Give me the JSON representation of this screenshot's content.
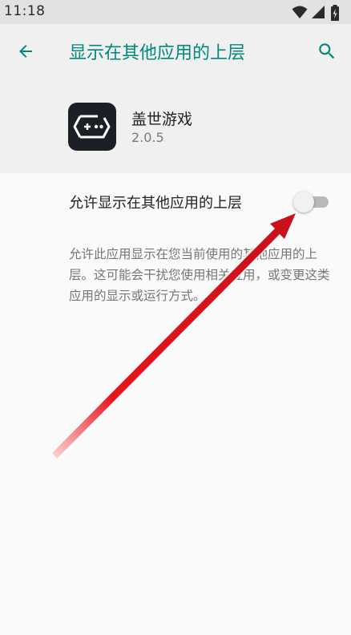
{
  "status_bar": {
    "time": "11:18",
    "icons": [
      "wifi-icon",
      "signal-icon",
      "battery-icon"
    ]
  },
  "toolbar": {
    "title": "显示在其他应用的上层",
    "back_icon": "back-arrow-icon",
    "search_icon": "search-icon"
  },
  "app": {
    "name": "盖世游戏",
    "version": "2.0.5",
    "icon": "gamepad-icon"
  },
  "setting": {
    "label": "允许显示在其他应用的上层",
    "enabled": false
  },
  "description": "允许此应用显示在您当前使用的其他应用的上层。这可能会干扰您使用相关应用，或变更这类应用的显示或运行方式。",
  "colors": {
    "accent": "#00897b",
    "header_bg": "#f0f0f0",
    "page_bg": "#fafafa",
    "status_bar_bg": "#e2e2e2",
    "annotation_arrow": "#e8141b"
  }
}
